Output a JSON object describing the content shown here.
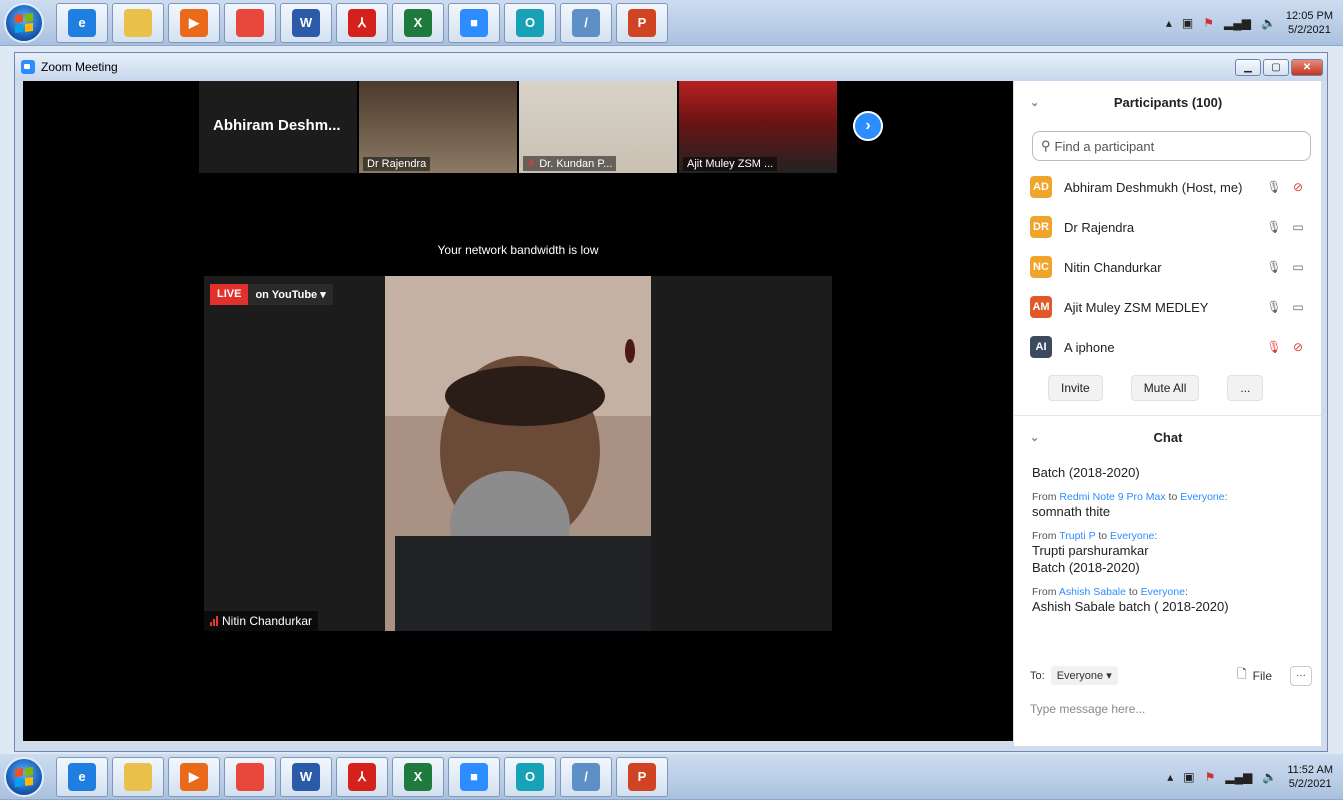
{
  "taskbar_top": {
    "clock_time": "12:05 PM",
    "clock_date": "5/2/2021",
    "apps": [
      {
        "name": "internet-explorer-icon",
        "glyph": "e",
        "color": "#1e7fe0"
      },
      {
        "name": "explorer-icon",
        "glyph": "",
        "color": "#e9c04a"
      },
      {
        "name": "media-player-icon",
        "glyph": "▶",
        "color": "#e86a1a"
      },
      {
        "name": "chrome-icon",
        "glyph": "",
        "color": "#e8473b"
      },
      {
        "name": "word-icon",
        "glyph": "W",
        "color": "#2b5aa8"
      },
      {
        "name": "acrobat-icon",
        "glyph": "⅄",
        "color": "#d5211c"
      },
      {
        "name": "excel-icon",
        "glyph": "X",
        "color": "#1f7a3e"
      },
      {
        "name": "zoom-icon",
        "glyph": "■",
        "color": "#2d8cff"
      },
      {
        "name": "app-circle-icon",
        "glyph": "O",
        "color": "#17a2b8"
      },
      {
        "name": "app-note-icon",
        "glyph": "/",
        "color": "#5f8fc7"
      },
      {
        "name": "powerpoint-icon",
        "glyph": "P",
        "color": "#d04423"
      }
    ]
  },
  "taskbar_bottom": {
    "clock_time": "11:52 AM",
    "clock_date": "5/2/2021"
  },
  "window": {
    "title": "Zoom Meeting"
  },
  "gallery": {
    "thumbs": [
      {
        "label": "Abhiram Deshm...",
        "type": "name"
      },
      {
        "label": "Dr Rajendra",
        "type": "video",
        "muted": false
      },
      {
        "label": "Dr. Kundan P...",
        "type": "video",
        "muted": true
      },
      {
        "label": "Ajit Muley ZSM ...",
        "type": "video",
        "muted": false
      }
    ]
  },
  "main": {
    "bandwidth_notice": "Your network bandwidth is low",
    "live_badge": "LIVE",
    "live_target": "on YouTube ▾",
    "speaker_name": "Nitin Chandurkar"
  },
  "participants": {
    "title": "Participants (100)",
    "search_placeholder": "Find a participant",
    "list": [
      {
        "initials": "AD",
        "color": "#f0a42a",
        "name": "Abhiram Deshmukh (Host, me)",
        "mic": "🎙",
        "cam": "⊘",
        "cam_red": true,
        "mic_red": false
      },
      {
        "initials": "DR",
        "color": "#f0a42a",
        "name": "Dr Rajendra",
        "mic": "🎙",
        "cam": "▭",
        "cam_red": false,
        "mic_red": false
      },
      {
        "initials": "NC",
        "color": "#f0a42a",
        "name": "Nitin Chandurkar",
        "mic": "🎙",
        "cam": "▭",
        "cam_red": false,
        "mic_red": false
      },
      {
        "initials": "AM",
        "color": "#e0592a",
        "name": "Ajit Muley ZSM MEDLEY",
        "mic": "🎙",
        "cam": "▭",
        "cam_red": false,
        "mic_red": false
      },
      {
        "initials": "AI",
        "color": "#3b4a5e",
        "name": "A iphone",
        "mic": "🎙",
        "cam": "⊘",
        "cam_red": true,
        "mic_red": true
      }
    ],
    "invite_label": "Invite",
    "mute_all_label": "Mute All",
    "more_label": "..."
  },
  "chat": {
    "title": "Chat",
    "first_line": "Batch (2018-2020)",
    "messages": [
      {
        "from": "Redmi Note 9 Pro Max",
        "to": "Everyone",
        "body": [
          "somnath thite"
        ]
      },
      {
        "from": "Trupti P",
        "to": "Everyone",
        "body": [
          "Trupti parshuramkar",
          "Batch (2018-2020)"
        ]
      },
      {
        "from": "Ashish Sabale",
        "to": "Everyone",
        "body": [
          "Ashish Sabale batch ( 2018-2020)"
        ]
      }
    ],
    "to_label": "To:",
    "to_value": "Everyone ▾",
    "file_label": "File",
    "placeholder": "Type message here..."
  }
}
